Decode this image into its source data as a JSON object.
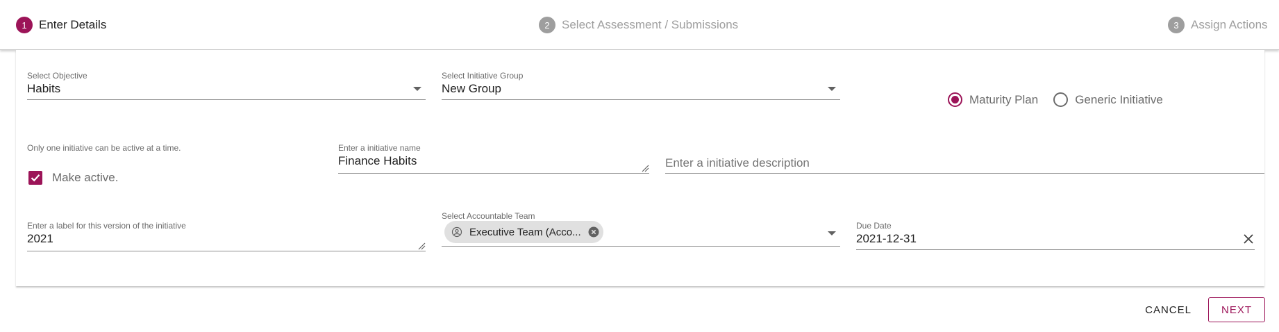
{
  "stepper": {
    "steps": [
      {
        "number": "1",
        "label": "Enter Details"
      },
      {
        "number": "2",
        "label": "Select Assessment / Submissions"
      },
      {
        "number": "3",
        "label": "Assign Actions"
      }
    ]
  },
  "form": {
    "objective": {
      "label": "Select Objective",
      "value": "Habits"
    },
    "initiative_group": {
      "label": "Select Initiative Group",
      "value": "New Group"
    },
    "plan_type": {
      "options": [
        {
          "label": "Maturity Plan",
          "selected": true
        },
        {
          "label": "Generic Initiative",
          "selected": false
        }
      ]
    },
    "active_hint": "Only one initiative can be active at a time.",
    "make_active": {
      "label": "Make active.",
      "checked": true
    },
    "initiative_name": {
      "label": "Enter a initiative name",
      "value": "Finance Habits"
    },
    "initiative_description": {
      "placeholder": "Enter a initiative description"
    },
    "version_label": {
      "label": "Enter a label for this version of the initiative",
      "value": "2021"
    },
    "accountable_team": {
      "label": "Select Accountable Team",
      "chip": "Executive Team (Acco..."
    },
    "due_date": {
      "label": "Due Date",
      "value": "2021-12-31"
    }
  },
  "actions": {
    "cancel": "CANCEL",
    "next": "NEXT"
  },
  "colors": {
    "accent": "#9c1458",
    "inactive": "#9e9e9e"
  }
}
